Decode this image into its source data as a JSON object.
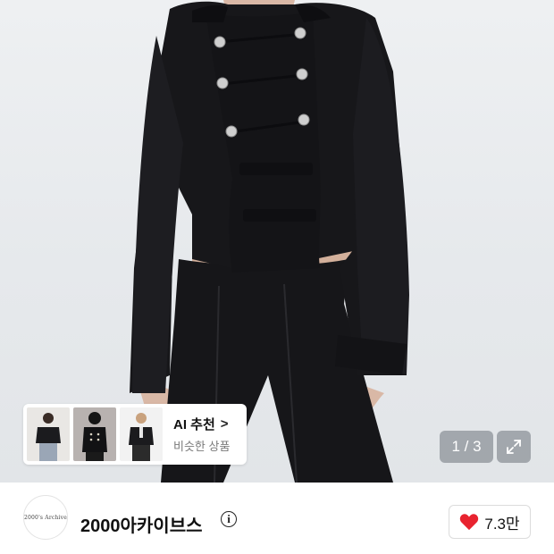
{
  "gallery": {
    "page_indicator": "1 / 3",
    "expand_icon": "expand-icon"
  },
  "ai_recommend": {
    "title": "AI 추천",
    "subtitle": "비슷한 상품",
    "chevron": ">",
    "thumbnails": [
      "thumbnail-1",
      "thumbnail-2",
      "thumbnail-3"
    ]
  },
  "shop": {
    "logo_text": "2000's Archive",
    "name": "2000아카이브스",
    "info_icon": "info-icon"
  },
  "like": {
    "count": "7.3만",
    "icon": "heart-icon",
    "color": "#e8232f"
  }
}
